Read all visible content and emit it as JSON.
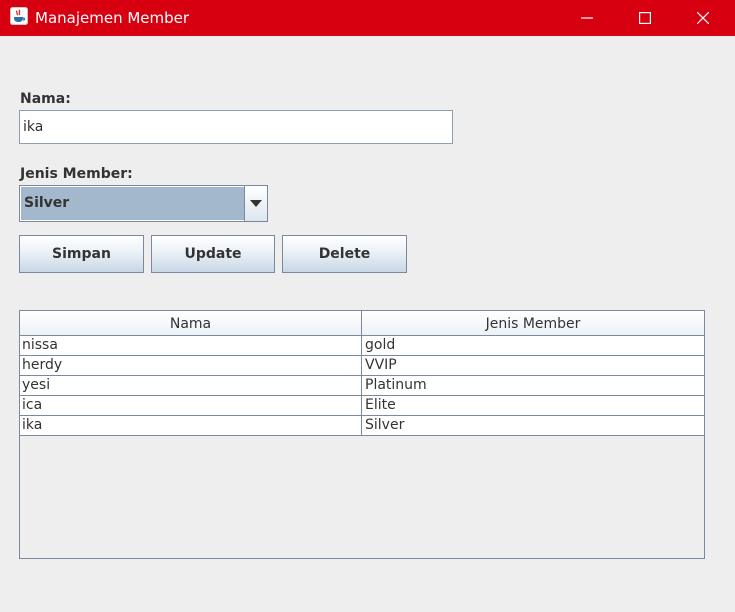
{
  "window": {
    "title": "Manajemen Member",
    "icon": "java-icon",
    "controls": [
      "minimize-icon",
      "maximize-icon",
      "close-icon"
    ]
  },
  "form": {
    "nama_label": "Nama:",
    "nama_value": "ika",
    "jenis_label": "Jenis Member:",
    "jenis_selected": "Silver"
  },
  "buttons": {
    "simpan": "Simpan",
    "update": "Update",
    "delete": "Delete"
  },
  "table": {
    "columns": [
      "Nama",
      "Jenis Member"
    ],
    "rows": [
      {
        "nama": "nissa",
        "jenis": "gold"
      },
      {
        "nama": "herdy",
        "jenis": "VVIP"
      },
      {
        "nama": "yesi",
        "jenis": "Platinum"
      },
      {
        "nama": "ica",
        "jenis": "Elite"
      },
      {
        "nama": "ika",
        "jenis": "Silver"
      }
    ]
  },
  "colors": {
    "titlebar": "#d60010",
    "background": "#eeeeee",
    "combo_selection": "#a3b8cc",
    "border": "#7a8a9c"
  }
}
